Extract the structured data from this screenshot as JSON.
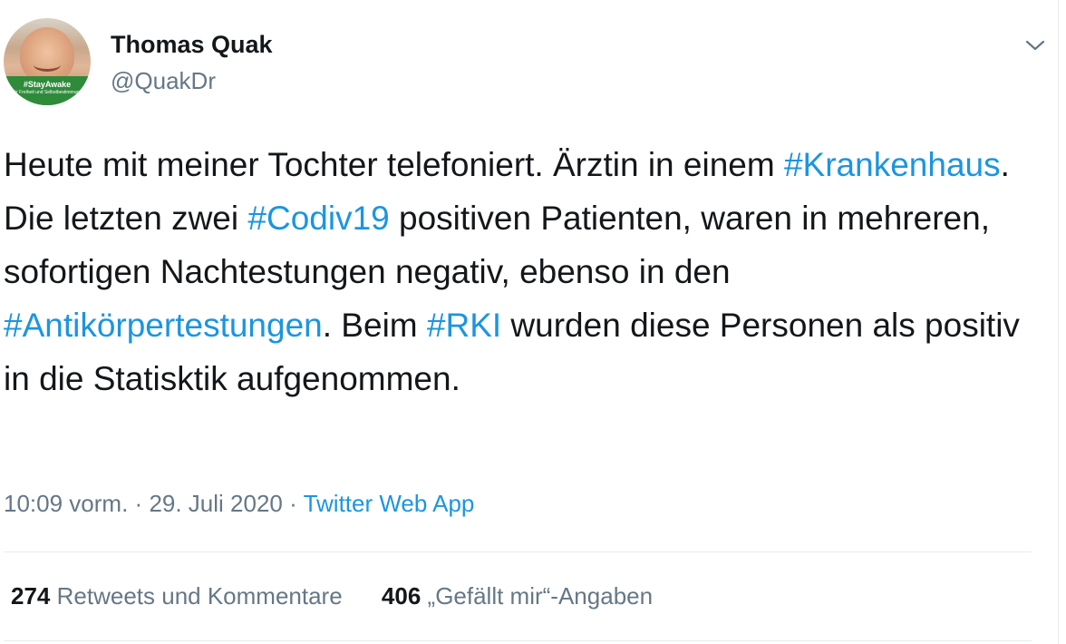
{
  "author": {
    "name": "Thomas Quak",
    "handle": "@QuakDr",
    "avatar_badge": "#StayAwake",
    "avatar_badge_sub": "für Freiheit und Selbstbestimmung"
  },
  "tweet": {
    "segments": [
      {
        "text": "Heute mit meiner Tochter telefoniert. Ärztin in einem ",
        "hashtag": false
      },
      {
        "text": "#Krankenhaus",
        "hashtag": true
      },
      {
        "text": ". Die letzten zwei ",
        "hashtag": false
      },
      {
        "text": "#Codiv19",
        "hashtag": true
      },
      {
        "text": " positiven Patienten, waren in mehreren, sofortigen Nachtestungen negativ, ebenso in den ",
        "hashtag": false
      },
      {
        "text": "#Antikörpertestungen",
        "hashtag": true
      },
      {
        "text": ". Beim ",
        "hashtag": false
      },
      {
        "text": "#RKI",
        "hashtag": true
      },
      {
        "text": " wurden diese Personen als positiv in die Statisktik aufgenommen.",
        "hashtag": false
      }
    ]
  },
  "meta": {
    "time": "10:09 vorm.",
    "separator": "·",
    "date": "29. Juli 2020",
    "source": "Twitter Web App"
  },
  "stats": {
    "retweets_count": "274",
    "retweets_label": "Retweets und Kommentare",
    "likes_count": "406",
    "likes_label": "„Gefällt mir“-Angaben"
  },
  "colors": {
    "link": "#1b95e0",
    "secondary": "#657786",
    "primary": "#14171a"
  },
  "icons": {
    "menu": "chevron-down-icon"
  }
}
